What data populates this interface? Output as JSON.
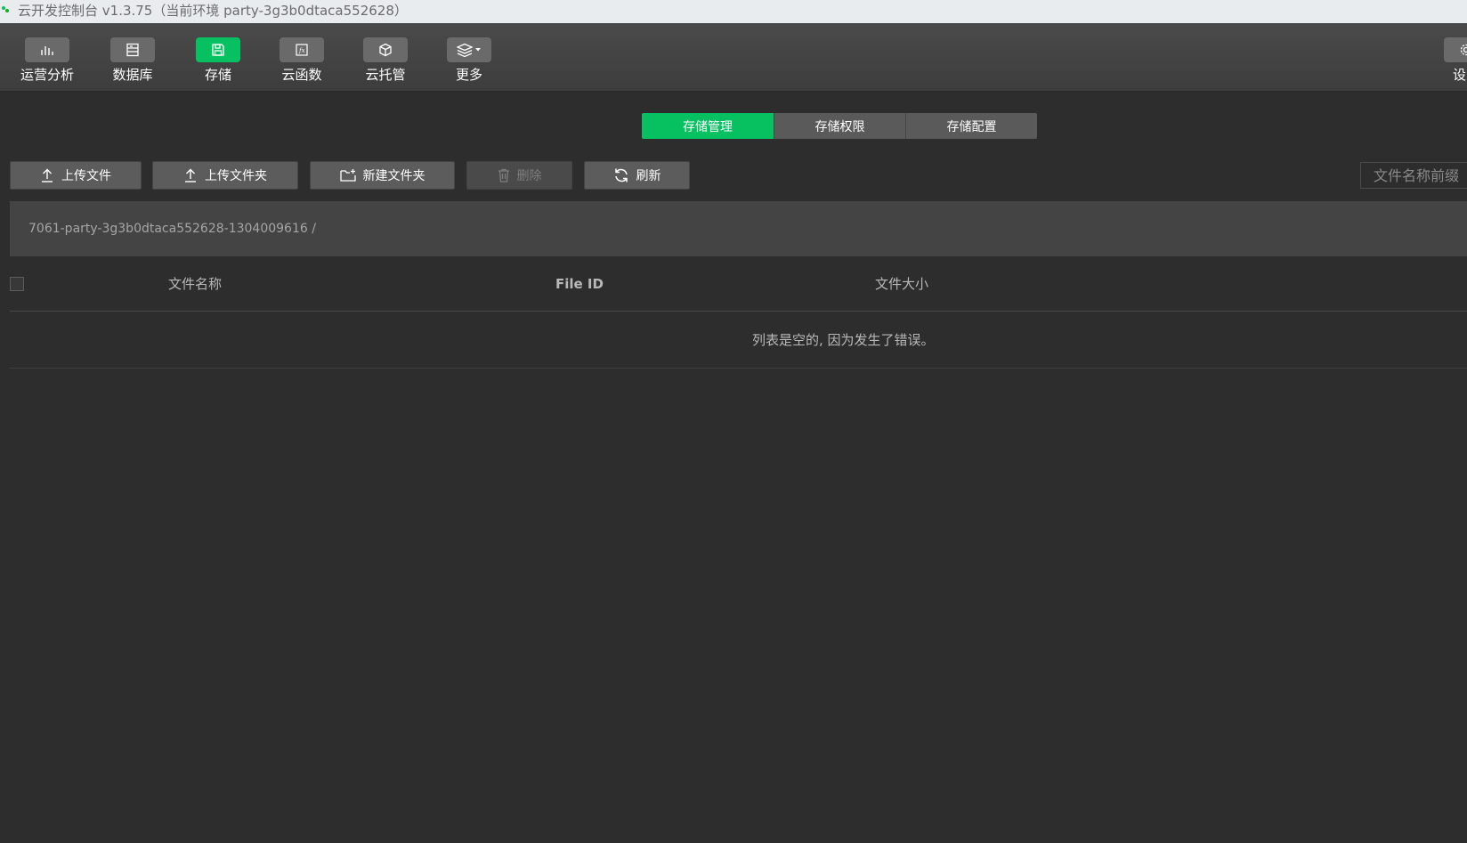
{
  "window": {
    "title": "云开发控制台 v1.3.75（当前环境 party-3g3b0dtaca552628）"
  },
  "toolbar": {
    "items": [
      {
        "label": "运营分析",
        "icon": "bar-chart-icon"
      },
      {
        "label": "数据库",
        "icon": "database-icon"
      },
      {
        "label": "存储",
        "icon": "storage-icon"
      },
      {
        "label": "云函数",
        "icon": "function-icon"
      },
      {
        "label": "云托管",
        "icon": "cube-icon"
      },
      {
        "label": "更多",
        "icon": "layers-icon"
      }
    ],
    "active_index": 2,
    "settings_label": "设"
  },
  "tabs": [
    {
      "label": "存储管理",
      "active": true
    },
    {
      "label": "存储权限",
      "active": false
    },
    {
      "label": "存储配置",
      "active": false
    }
  ],
  "actions": {
    "upload_file": "上传文件",
    "upload_folder": "上传文件夹",
    "new_folder": "新建文件夹",
    "delete": "删除",
    "refresh": "刷新"
  },
  "search": {
    "placeholder": "文件名称前缀"
  },
  "breadcrumb": {
    "path": "7061-party-3g3b0dtaca552628-1304009616 /"
  },
  "table": {
    "columns": [
      "文件名称",
      "File ID",
      "文件大小"
    ],
    "empty_message": "列表是空的, 因为发生了错误。"
  },
  "colors": {
    "accent": "#07c160",
    "background": "#2d2d2d",
    "toolbar": "#444444"
  }
}
